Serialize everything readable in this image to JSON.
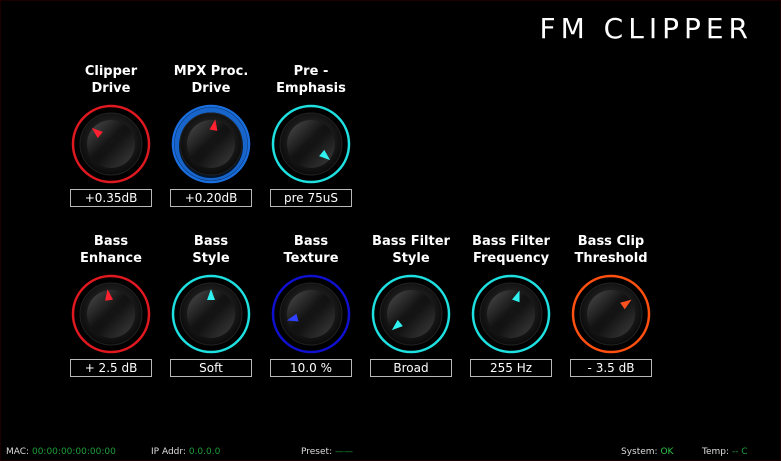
{
  "title": "FM CLIPPER",
  "knobs": [
    {
      "label1": "Clipper",
      "label2": "Drive",
      "value": "+0.35dB",
      "ring": "#e01820",
      "pointer": "#ff2030",
      "angle": -50,
      "halo": false
    },
    {
      "label1": "MPX Proc.",
      "label2": "Drive",
      "value": "+0.20dB",
      "ring": "#1a6fe0",
      "pointer": "#ff2030",
      "angle": 10,
      "halo": true
    },
    {
      "label1": "Pre -",
      "label2": "Emphasis",
      "value": "pre 75uS",
      "ring": "#1ee0e0",
      "pointer": "#30f0f0",
      "angle": 130,
      "halo": false
    },
    {
      "label1": "Bass",
      "label2": "Enhance",
      "value": "+ 2.5 dB",
      "ring": "#e01820",
      "pointer": "#ff2030",
      "angle": -8,
      "halo": false
    },
    {
      "label1": "Bass",
      "label2": "Style",
      "value": "Soft",
      "ring": "#1ee0e0",
      "pointer": "#30f0f0",
      "angle": 0,
      "halo": false
    },
    {
      "label1": "Bass",
      "label2": "Texture",
      "value": "10.0 %",
      "ring": "#1010d0",
      "pointer": "#3040ff",
      "angle": -105,
      "halo": false
    },
    {
      "label1": "Bass Filter",
      "label2": "Style",
      "value": "Broad",
      "ring": "#1ee0e0",
      "pointer": "#30f0f0",
      "angle": -130,
      "halo": false
    },
    {
      "label1": "Bass Filter",
      "label2": "Frequency",
      "value": "255 Hz",
      "ring": "#1ee0e0",
      "pointer": "#30f0f0",
      "angle": 20,
      "halo": false
    },
    {
      "label1": "Bass Clip",
      "label2": "Threshold",
      "value": "- 3.5 dB",
      "ring": "#ff5010",
      "pointer": "#ff5020",
      "angle": 55,
      "halo": false
    }
  ],
  "status": {
    "mac_label": "MAC:",
    "mac_value": "00:00:00:00:00:00",
    "ip_label": "IP Addr:",
    "ip_value": "0.0.0.0",
    "preset_label": "Preset:",
    "preset_value": "——",
    "system_label": "System:",
    "system_value": "OK",
    "temp_label": "Temp:",
    "temp_value": "-- C"
  }
}
